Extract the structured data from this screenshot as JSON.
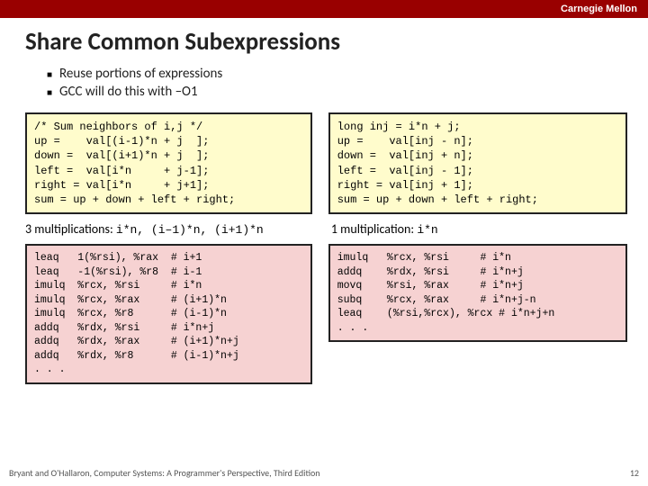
{
  "header": {
    "org": "Carnegie Mellon"
  },
  "title": "Share Common Subexpressions",
  "bullets": [
    "Reuse portions of expressions",
    "GCC will do this with –O1"
  ],
  "left": {
    "code1": "/* Sum neighbors of i,j */\nup =    val[(i-1)*n + j  ];\ndown =  val[(i+1)*n + j  ];\nleft =  val[i*n     + j-1];\nright = val[i*n     + j+1];\nsum = up + down + left + right;",
    "caption_prefix": "3 multiplications: ",
    "caption_code": "i*n, (i–1)*n, (i+1)*n",
    "code2": "leaq   1(%rsi), %rax  # i+1\nleaq   -1(%rsi), %r8  # i-1\nimulq  %rcx, %rsi     # i*n\nimulq  %rcx, %rax     # (i+1)*n\nimulq  %rcx, %r8      # (i-1)*n\naddq   %rdx, %rsi     # i*n+j\naddq   %rdx, %rax     # (i+1)*n+j\naddq   %rdx, %r8      # (i-1)*n+j\n. . ."
  },
  "right": {
    "code1": "long inj = i*n + j;\nup =    val[inj - n];\ndown =  val[inj + n];\nleft =  val[inj - 1];\nright = val[inj + 1];\nsum = up + down + left + right;",
    "caption_prefix": "1 multiplication: ",
    "caption_code": "i*n",
    "code2": "imulq   %rcx, %rsi     # i*n\naddq    %rdx, %rsi     # i*n+j\nmovq    %rsi, %rax     # i*n+j\nsubq    %rcx, %rax     # i*n+j-n\nleaq    (%rsi,%rcx), %rcx # i*n+j+n\n. . ."
  },
  "footer": {
    "left": "Bryant and O'Hallaron, Computer Systems: A Programmer's Perspective, Third Edition",
    "right": "12"
  }
}
